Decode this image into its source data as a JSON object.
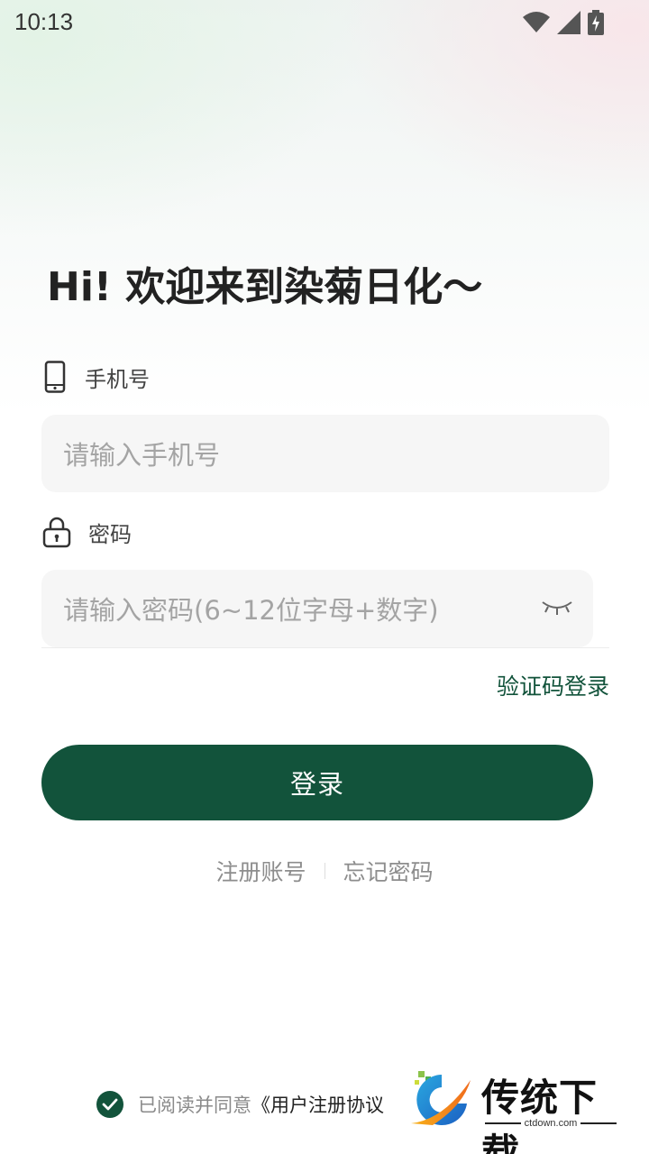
{
  "status_bar": {
    "time": "10:13"
  },
  "greeting": "Hi! 欢迎来到染菊日化～",
  "phone": {
    "label": "手机号",
    "placeholder": "请输入手机号"
  },
  "password": {
    "label": "密码",
    "placeholder": "请输入密码(6~12位字母+数字)"
  },
  "sms_login_label": "验证码登录",
  "login_button_label": "登录",
  "links": {
    "register": "注册账号",
    "forgot": "忘记密码"
  },
  "agreement": {
    "prefix": "已阅读并同意",
    "protocol": "《用户注册协议"
  },
  "watermark": {
    "title": "传统下载",
    "site": "ctdown.com"
  },
  "colors": {
    "primary": "#12533b",
    "input_bg": "#f6f6f6",
    "placeholder": "#a4a4a4"
  },
  "icons": [
    "wifi-icon",
    "signal-icon",
    "battery-charging-icon",
    "phone-icon",
    "lock-icon",
    "eye-closed-icon",
    "check-icon"
  ]
}
